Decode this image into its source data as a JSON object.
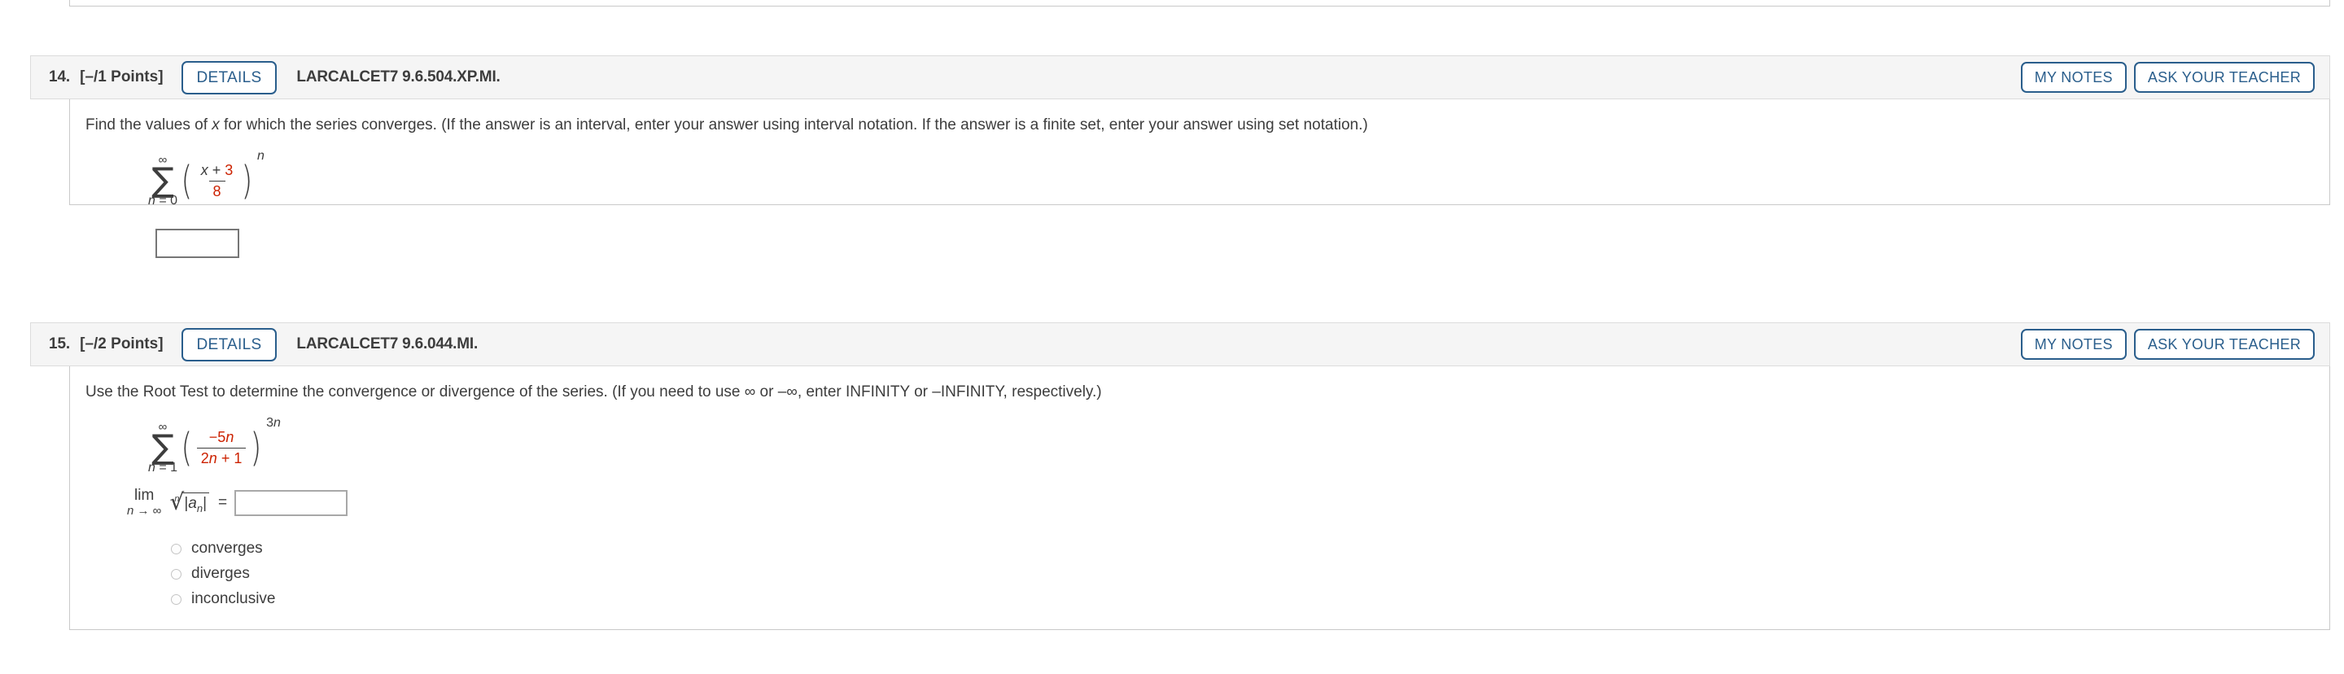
{
  "page": {
    "background_color": "#ffffff",
    "accent_color": "#2a5e8c",
    "math_highlight_color": "#cc2200",
    "text_color": "#3d3d3d",
    "header_bar_color": "#f5f5f5",
    "border_color": "#c9c9c9"
  },
  "questions": [
    {
      "number": "14.",
      "points": "[–/1 Points]",
      "details_label": "DETAILS",
      "code": "LARCALCET7 9.6.504.XP.MI.",
      "my_notes_label": "MY NOTES",
      "ask_teacher_label": "ASK YOUR TEACHER",
      "prompt": "Find the values of x for which the series converges. (If the answer is an interval, enter your answer using interval notation. If the answer is a finite set, enter your answer using set notation.)",
      "prompt_parts": {
        "before_var": "Find the values of ",
        "var": "x",
        "after_var": " for which the series converges. (If the answer is an interval, enter your answer using interval notation. If the answer is a finite set, enter your answer using set notation.)"
      },
      "math": {
        "sum_upper": "∞",
        "sum_lower_var": "n",
        "sum_lower_eq": " = 0",
        "numerator_var": "x",
        "numerator_op": " + ",
        "numerator_const": "3",
        "denominator": "8",
        "exponent": "n"
      },
      "answer_value": "",
      "answer_placeholder": ""
    },
    {
      "number": "15.",
      "points": "[–/2 Points]",
      "details_label": "DETAILS",
      "code": "LARCALCET7 9.6.044.MI.",
      "my_notes_label": "MY NOTES",
      "ask_teacher_label": "ASK YOUR TEACHER",
      "prompt": "Use the Root Test to determine the convergence or divergence of the series. (If you need to use ∞ or –∞, enter INFINITY or –INFINITY, respectively.)",
      "prompt_parts": {
        "before_inf": "Use the Root Test to determine the convergence or divergence of the series. (If you need to use ",
        "inf1": "∞",
        "mid": " or ",
        "inf2": "–∞",
        "after_inf": ", enter INFINITY or –INFINITY, respectively.)"
      },
      "math": {
        "sum_upper": "∞",
        "sum_lower_var": "n",
        "sum_lower_eq": " = 1",
        "numerator_sign": "−5",
        "numerator_var": "n",
        "denominator_coef": "2",
        "denominator_var": "n",
        "denominator_rest": " + 1",
        "exponent_coef": "3",
        "exponent_var": "n"
      },
      "limit": {
        "lim_label": "lim",
        "lim_sub_var": "n",
        "lim_sub_rest": " → ∞",
        "radical_index": "n",
        "radical_sign": "√",
        "radicand_bar_left": "|",
        "radicand_var": "a",
        "radicand_sub": "n",
        "radicand_bar_right": "|",
        "equals": "="
      },
      "answer_value": "",
      "answer_placeholder": "",
      "options": [
        {
          "label": "converges",
          "selected": false
        },
        {
          "label": "diverges",
          "selected": false
        },
        {
          "label": "inconclusive",
          "selected": false
        }
      ]
    }
  ]
}
